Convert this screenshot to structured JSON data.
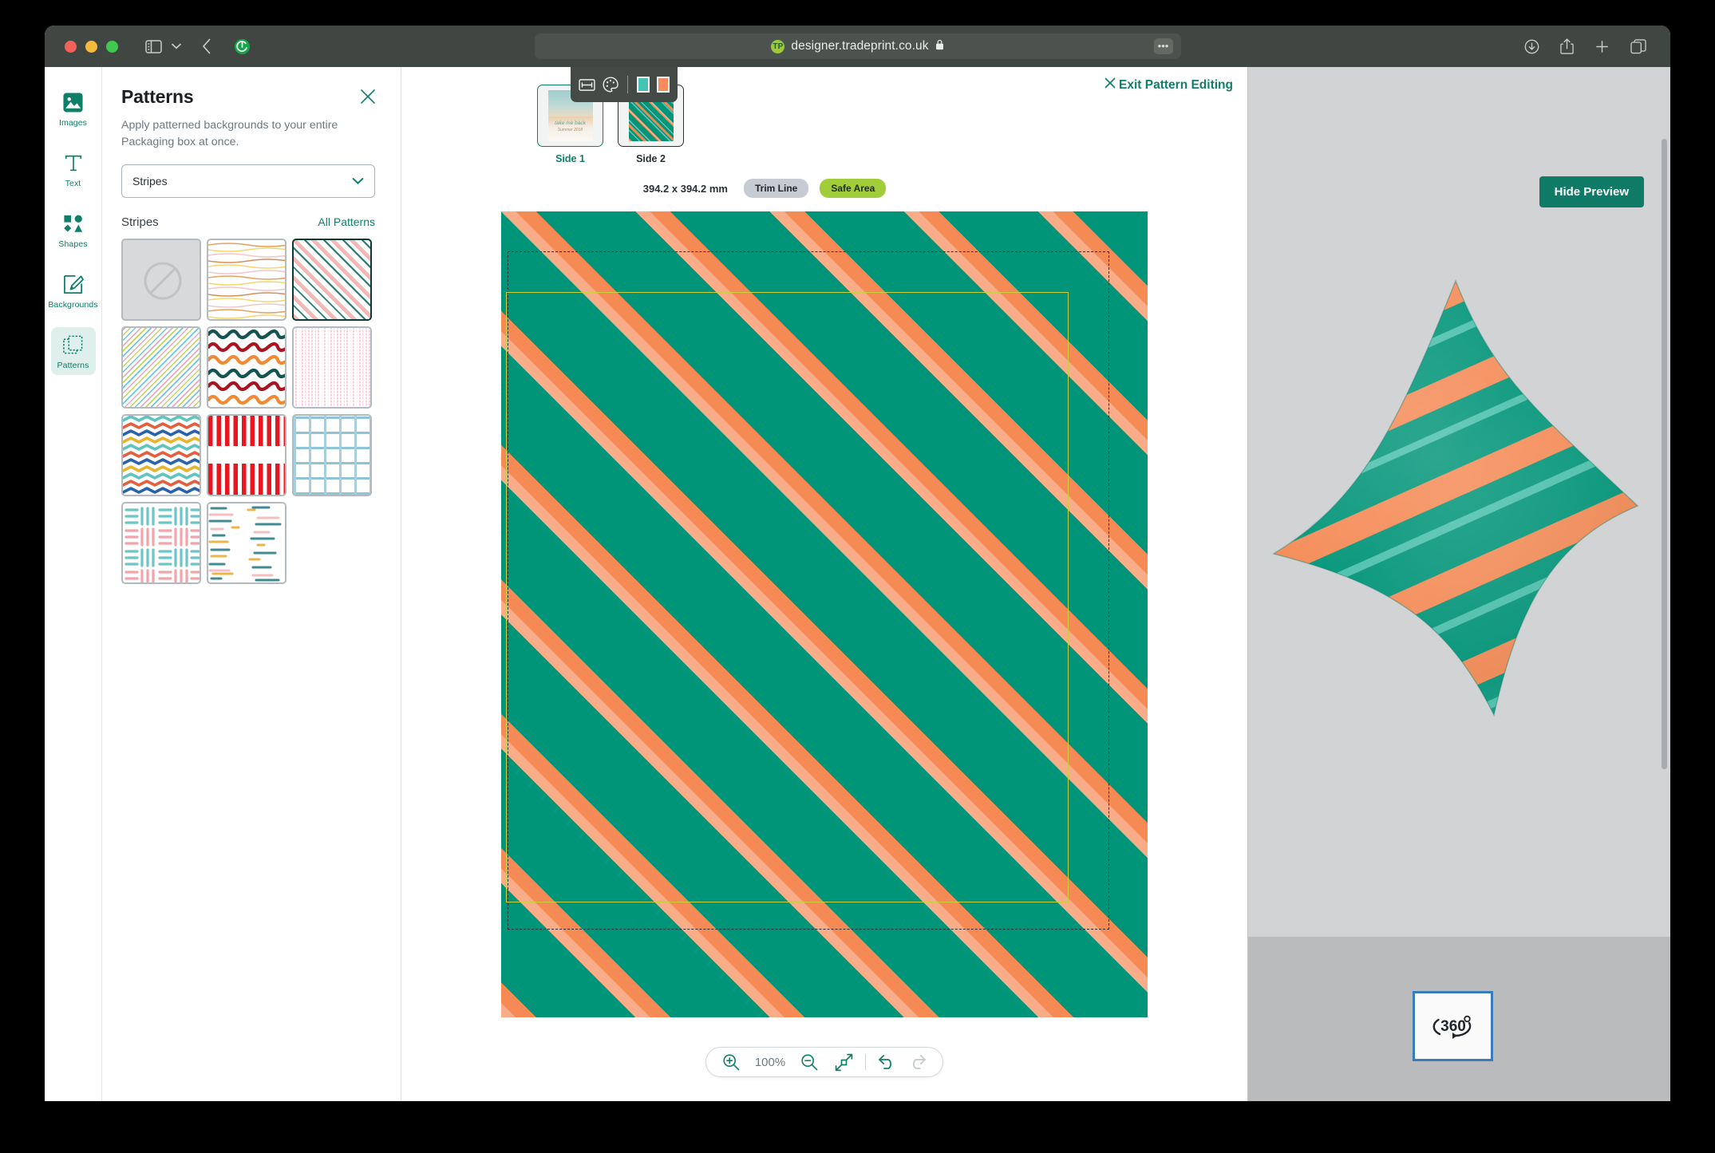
{
  "browser": {
    "url": "designer.tradeprint.co.uk",
    "logo_text": "TP",
    "lock_icon": "lock-icon",
    "icons": {
      "sidebar": "sidebar-toggle-icon",
      "chevron": "chevron-down-icon",
      "back": "back-chevron-icon",
      "reload": "reload-icon",
      "more": "more-ellipsis-icon",
      "download": "download-icon",
      "share": "share-icon",
      "new_tab": "plus-icon",
      "tabs": "tabs-overview-icon"
    }
  },
  "rail": {
    "items": [
      {
        "label": "Images",
        "icon": "image-icon",
        "active": false
      },
      {
        "label": "Text",
        "icon": "text-icon",
        "active": false
      },
      {
        "label": "Shapes",
        "icon": "shapes-icon",
        "active": false
      },
      {
        "label": "Backgrounds",
        "icon": "brush-icon",
        "active": false
      },
      {
        "label": "Patterns",
        "icon": "patterns-icon",
        "active": true
      }
    ]
  },
  "panel": {
    "title": "Patterns",
    "description": "Apply patterned backgrounds to your entire Packaging box at once.",
    "close_icon": "close-icon",
    "category_selected": "Stripes",
    "category_chevron": "chevron-down-icon",
    "subhead": "Stripes",
    "all_patterns_link": "All Patterns",
    "patterns": [
      {
        "name": "none",
        "selected": false
      },
      {
        "name": "wavy-horizontal",
        "selected": false
      },
      {
        "name": "diagonal-duo",
        "selected": true
      },
      {
        "name": "diagonal-multi",
        "selected": false
      },
      {
        "name": "zigzag-wave",
        "selected": false
      },
      {
        "name": "vertical-pink",
        "selected": false
      },
      {
        "name": "chevron-multi",
        "selected": false
      },
      {
        "name": "red-vertical",
        "selected": false
      },
      {
        "name": "grid-blue",
        "selected": false
      },
      {
        "name": "dash-weave",
        "selected": false
      },
      {
        "name": "dash-scatter",
        "selected": false
      }
    ]
  },
  "canvas": {
    "exit_label": "Exit Pattern Editing",
    "exit_icon": "close-icon",
    "toolbar": {
      "resize_icon": "resize-icon",
      "palette_icon": "palette-icon",
      "color_1": "#45c4b5",
      "color_2": "#f98b5c"
    },
    "sides": [
      {
        "label": "Side 1",
        "selected": true
      },
      {
        "label": "Side 2",
        "selected": false
      }
    ],
    "side1_caption_1": "take me back",
    "side1_caption_2": "Summer 2018",
    "dimensions": "394.2 x 394.2 mm",
    "badge_trim": "Trim Line",
    "badge_safe": "Safe Area",
    "pattern_colors": {
      "base": "#009478",
      "stripe_orange": "#f58a55",
      "stripe_light": "#4bc0ab"
    },
    "zoombar": {
      "zoom_in_icon": "zoom-in-icon",
      "zoom_value": "100%",
      "zoom_out_icon": "zoom-out-icon",
      "fit_icon": "fit-screen-icon",
      "undo_icon": "undo-icon",
      "redo_icon": "redo-icon"
    }
  },
  "preview": {
    "hide_label": "Hide Preview",
    "rotate_label": "360",
    "rotate_degree": "°",
    "rotate_icon": "rotate-360-icon"
  }
}
